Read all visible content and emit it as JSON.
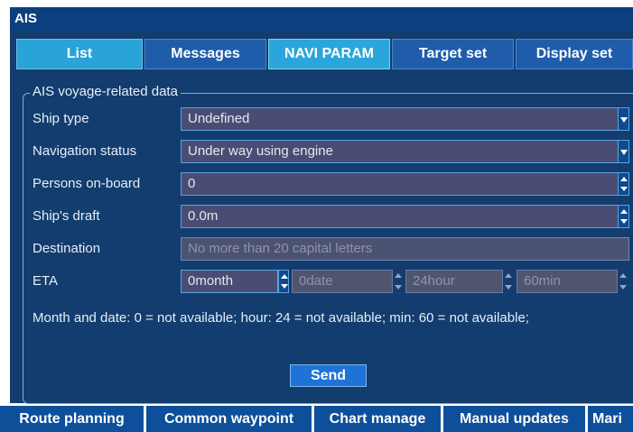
{
  "window": {
    "title": "AIS"
  },
  "tabs": [
    {
      "label": "List"
    },
    {
      "label": "Messages"
    },
    {
      "label": "NAVI PARAM"
    },
    {
      "label": "Target set"
    },
    {
      "label": "Display set"
    }
  ],
  "group": {
    "legend": "AIS voyage-related data",
    "ship_type": {
      "label": "Ship type",
      "value": "Undefined"
    },
    "nav_status": {
      "label": "Navigation status",
      "value": "Under way using engine"
    },
    "persons": {
      "label": "Persons on-board",
      "value": "0"
    },
    "draft": {
      "label": "Ship's draft",
      "value": "0.0m"
    },
    "destination": {
      "label": "Destination",
      "placeholder": "No more than 20 capital letters"
    },
    "eta": {
      "label": "ETA",
      "month": "0month",
      "date": "0date",
      "hour": "24hour",
      "min": "60min"
    },
    "note": "Month and date: 0 = not available; hour: 24 = not available; min: 60 = not available;",
    "send_label": "Send"
  },
  "bottom_tabs": [
    {
      "label": "Route planning"
    },
    {
      "label": "Common waypoint"
    },
    {
      "label": "Chart manage"
    },
    {
      "label": "Manual updates"
    },
    {
      "label": "Mari"
    }
  ],
  "colors": {
    "title_bar": "#0b3f7e",
    "panel": "#123d6e",
    "tab": "#1f5dab",
    "tab_active": "#2ba6dc",
    "field": "#4a4d73",
    "send": "#1e74d6"
  }
}
